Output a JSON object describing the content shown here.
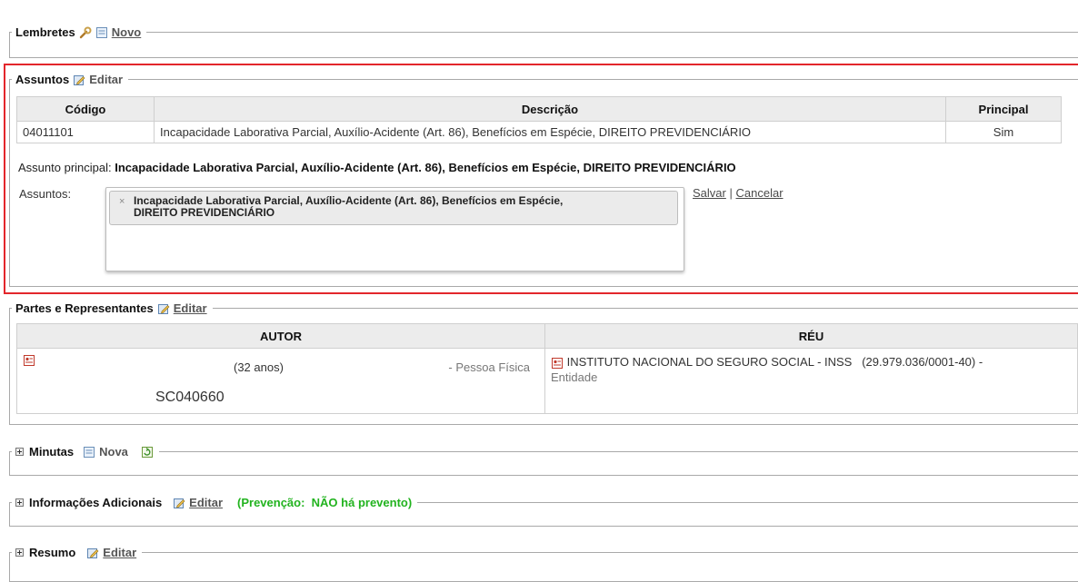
{
  "lembretes": {
    "title": "Lembretes",
    "novo_label": "Novo"
  },
  "assuntos": {
    "title": "Assuntos",
    "editar_label": "Editar",
    "table": {
      "headers": [
        "Código",
        "Descrição",
        "Principal"
      ],
      "row": [
        "04011101",
        "Incapacidade Laborativa Parcial, Auxílio-Acidente (Art. 86), Benefícios em Espécie, DIREITO PREVIDENCIÁRIO",
        "Sim"
      ]
    },
    "principal_label": "Assunto principal:",
    "principal_value": "Incapacidade Laborativa Parcial, Auxílio-Acidente (Art. 86), Benefícios em Espécie, DIREITO PREVIDENCIÁRIO",
    "assuntos_label": "Assuntos:",
    "chip_remove": "×",
    "chip_line1": "Incapacidade Laborativa Parcial, Auxílio-Acidente (Art. 86), Benefícios em Espécie,",
    "chip_line2": "DIREITO PREVIDENCIÁRIO",
    "salvar_label": "Salvar",
    "separator": "|",
    "cancelar_label": "Cancelar",
    "highlight_color": "#e3262b"
  },
  "partes": {
    "title": "Partes e Representantes",
    "editar_label": "Editar",
    "headers": [
      "AUTOR",
      "RÉU"
    ],
    "autor": {
      "idade": "(32 anos)",
      "tipo": "- Pessoa Física",
      "oab": "SC040660"
    },
    "reu": {
      "nome": "INSTITUTO NACIONAL DO SEGURO SOCIAL - INSS",
      "cnpj": "(29.979.036/0001-40)",
      "dash": "-",
      "tipo": "Entidade"
    }
  },
  "minutas": {
    "title": "Minutas",
    "nova_label": "Nova"
  },
  "informacoes": {
    "title": "Informações Adicionais",
    "editar_label": "Editar",
    "prevencao": "(Prevenção:  NÃO há prevento)",
    "prevencao_color": "#22b31f"
  },
  "resumo": {
    "title": "Resumo",
    "editar_label": "Editar"
  },
  "icons": [
    "wrench-icon",
    "note-icon",
    "edit-icon",
    "person-card-icon",
    "plus-toggle-icon",
    "refresh-doc-icon"
  ]
}
